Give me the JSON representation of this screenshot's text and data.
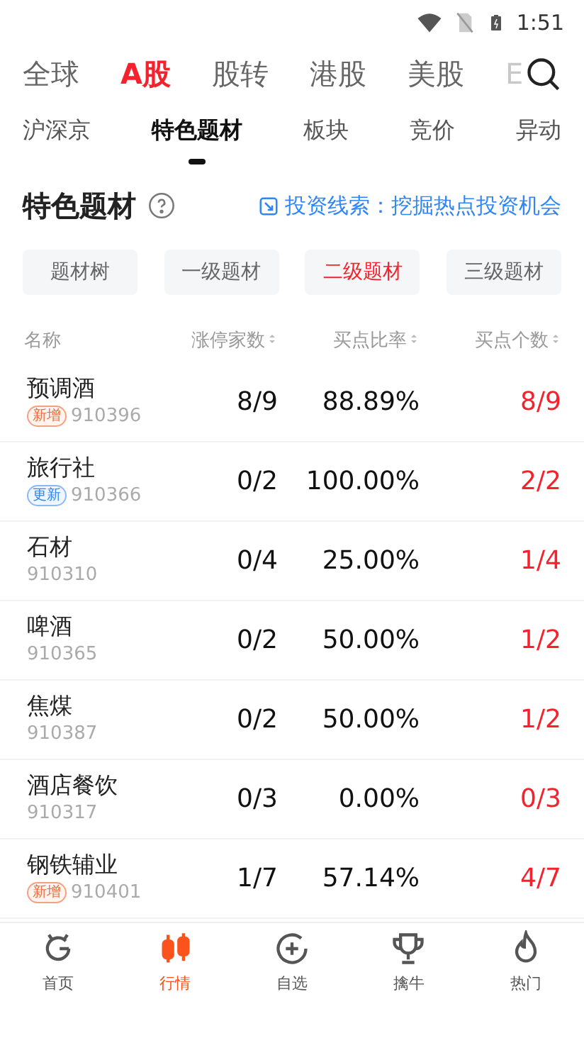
{
  "status_bar": {
    "time": "1:51"
  },
  "market_tabs": [
    {
      "label": "全球",
      "selected": false
    },
    {
      "label": "A股",
      "selected": true
    },
    {
      "label": "股转",
      "selected": false
    },
    {
      "label": "港股",
      "selected": false
    },
    {
      "label": "美股",
      "selected": false
    },
    {
      "label": "E",
      "selected": false,
      "faded": true
    }
  ],
  "sub_tabs": [
    {
      "label": "沪深京",
      "selected": false
    },
    {
      "label": "特色题材",
      "selected": true
    },
    {
      "label": "板块",
      "selected": false
    },
    {
      "label": "竞价",
      "selected": false
    },
    {
      "label": "异动",
      "selected": false
    }
  ],
  "section": {
    "title": "特色题材",
    "link": "投资线索：挖掘热点投资机会"
  },
  "filters": [
    {
      "label": "题材树",
      "selected": false
    },
    {
      "label": "一级题材",
      "selected": false
    },
    {
      "label": "二级题材",
      "selected": true
    },
    {
      "label": "三级题材",
      "selected": false
    }
  ],
  "table": {
    "columns": [
      "名称",
      "涨停家数",
      "买点比率",
      "买点个数"
    ],
    "rows": [
      {
        "name": "预调酒",
        "tag": {
          "kind": "new",
          "label": "新增"
        },
        "code": "910396",
        "limit_up": "8/9",
        "ratio": "88.89%",
        "count": "8/9"
      },
      {
        "name": "旅行社",
        "tag": {
          "kind": "update",
          "label": "更新"
        },
        "code": "910366",
        "limit_up": "0/2",
        "ratio": "100.00%",
        "count": "2/2"
      },
      {
        "name": "石材",
        "code": "910310",
        "limit_up": "0/4",
        "ratio": "25.00%",
        "count": "1/4"
      },
      {
        "name": "啤酒",
        "code": "910365",
        "limit_up": "0/2",
        "ratio": "50.00%",
        "count": "1/2"
      },
      {
        "name": "焦煤",
        "code": "910387",
        "limit_up": "0/2",
        "ratio": "50.00%",
        "count": "1/2"
      },
      {
        "name": "酒店餐饮",
        "code": "910317",
        "limit_up": "0/3",
        "ratio": "0.00%",
        "count": "0/3"
      },
      {
        "name": "钢铁辅业",
        "tag": {
          "kind": "new",
          "label": "新增"
        },
        "code": "910401",
        "limit_up": "1/7",
        "ratio": "57.14%",
        "count": "4/7"
      }
    ]
  },
  "bottom_nav": [
    {
      "label": "首页",
      "kind": "home",
      "selected": false
    },
    {
      "label": "行情",
      "kind": "market",
      "selected": true
    },
    {
      "label": "自选",
      "kind": "watch",
      "selected": false
    },
    {
      "label": "擒牛",
      "kind": "trophy",
      "selected": false
    },
    {
      "label": "热门",
      "kind": "hot",
      "selected": false
    }
  ]
}
